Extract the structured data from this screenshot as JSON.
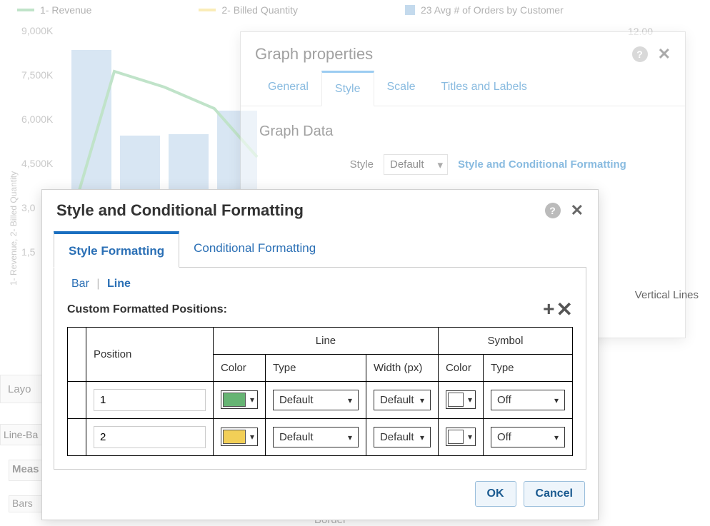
{
  "legend": {
    "revenue": "1- Revenue",
    "billed": "2- Billed Quantity",
    "orders": "23 Avg # of Orders by Customer"
  },
  "y_ticks": [
    "9,000K",
    "7,500K",
    "6,000K",
    "4,500K",
    "3,0",
    "1,5"
  ],
  "y2_tick": "12.00",
  "y_axis_label": "1- Revenue, 2- Billed Quantity",
  "chart_data": {
    "type": "bar",
    "ylabel": "1- Revenue, 2- Billed Quantity",
    "ylim_left": [
      0,
      9000
    ],
    "ylim_right_max": 12.0,
    "bars_series_name": "23 Avg # of Orders by Customer",
    "bar_heights_k": [
      8050,
      4900,
      4950,
      5850
    ],
    "line_series": [
      {
        "name": "1- Revenue",
        "color": "#76c38a",
        "points_k": [
          3150,
          7600,
          7050,
          6150,
          4600
        ]
      },
      {
        "name": "2- Billed Quantity",
        "color": "#f4d664"
      }
    ]
  },
  "graph_properties": {
    "title": "Graph properties",
    "tabs": {
      "general": "General",
      "style": "Style",
      "scale": "Scale",
      "titles": "Titles and Labels"
    },
    "section": "Graph Data",
    "style_label": "Style",
    "style_value": "Default",
    "link": "Style and Conditional Formatting",
    "vertical_lines": "Vertical Lines"
  },
  "scf": {
    "title": "Style and Conditional Formatting",
    "tabs": {
      "style": "Style Formatting",
      "cond": "Conditional Formatting"
    },
    "subtabs": {
      "bar": "Bar",
      "line": "Line"
    },
    "cfp": "Custom Formatted Positions:",
    "columns": {
      "position": "Position",
      "line": "Line",
      "symbol": "Symbol",
      "color": "Color",
      "type": "Type",
      "width": "Width (px)"
    },
    "rows": [
      {
        "position": "1",
        "lineColor": "#66b473",
        "lineType": "Default",
        "lineWidth": "Default",
        "symColor": "#ffffff",
        "symType": "Off"
      },
      {
        "position": "2",
        "lineColor": "#f2cf57",
        "lineType": "Default",
        "lineWidth": "Default",
        "symColor": "#ffffff",
        "symType": "Off"
      }
    ],
    "buttons": {
      "ok": "OK",
      "cancel": "Cancel"
    }
  },
  "bg": {
    "layout": "Layo",
    "lineBar": "Line-Ba",
    "meas": "Meas",
    "bars": "Bars",
    "border": "Border"
  }
}
